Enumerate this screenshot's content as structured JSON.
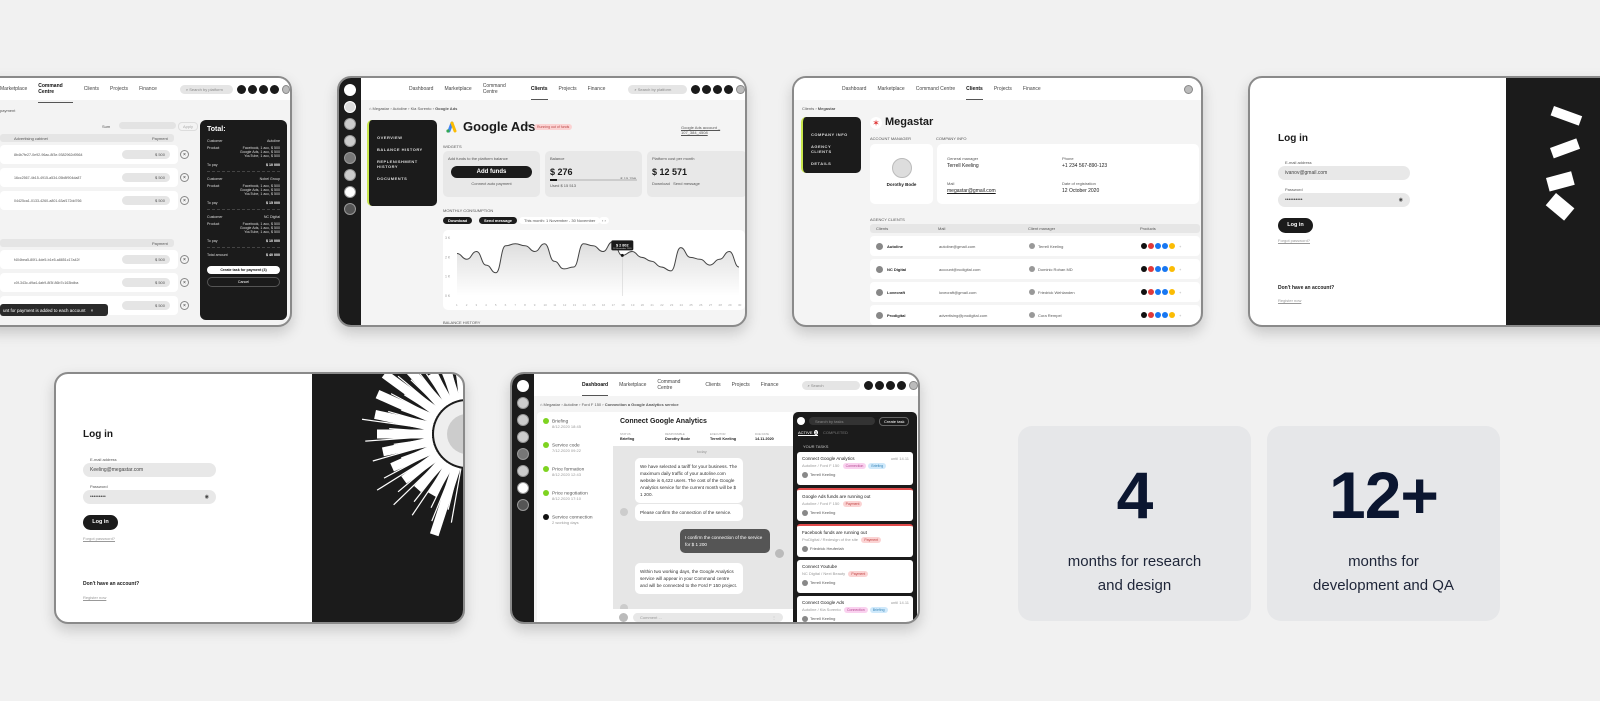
{
  "nav": {
    "items": [
      "Dashboard",
      "Marketplace",
      "Command Centre",
      "Clients",
      "Projects",
      "Finance"
    ]
  },
  "screen_payment": {
    "nav_items": [
      "Marketplace",
      "Command Centre",
      "Clients",
      "Projects",
      "Finance"
    ],
    "active": "Command Centre",
    "search_placeholder": "Search by platform",
    "breadcrumb": "payment",
    "sum_label": "Sum",
    "apply_label": "Apply",
    "col_account": "Advertising cabinet",
    "col_payment": "Payment",
    "rows_a": [
      {
        "id": "8b4b7fe27-0e92-96ac-8f3e-9382962d9564",
        "amount": "$ 500"
      },
      {
        "id": "16cc2567-4b15-4915-a534-05b8f904da87",
        "amount": "$ 500"
      },
      {
        "id": "04425ca1-0133-4260-a801-63af172dd766",
        "amount": "$ 500"
      }
    ],
    "rows_b": [
      {
        "id": "f404bea5-80f1-4de5-b1e5-a8851c17a42f",
        "amount": "$ 500"
      },
      {
        "id": "c0f-343c-d9a4-4ab9-8f3f-86b7c163bdba",
        "amount": "$ 500"
      },
      {
        "id": "",
        "amount": "$ 500"
      }
    ],
    "toast": "unt for payment is added to each account",
    "total": {
      "title": "Total:",
      "customers": [
        {
          "label": "Customer",
          "name": "Autoline",
          "products": [
            "Facebook, 1 acc, $ 500",
            "Google Ads, 1 acc, $ 500",
            "YouTube, 1 acc, $ 500"
          ],
          "to_pay": "$ 10 000"
        },
        {
          "label": "Customer",
          "name": "Nobel Group",
          "products": [
            "Facebook, 1 acc, $ 500",
            "Google Ads, 1 acc, $ 500",
            "YouTube, 1 acc, $ 500"
          ],
          "to_pay": "$ 15 000"
        },
        {
          "label": "Customer",
          "name": "NC Digital",
          "products": [
            "Facebook, 1 acc, $ 500",
            "Google Ads, 1 acc, $ 500",
            "YouTube, 1 acc, $ 500"
          ],
          "to_pay": "$ 10 000"
        }
      ],
      "product_label": "Product",
      "to_pay_label": "To pay",
      "total_amount_label": "Total amount",
      "total_amount": "$ 40 000",
      "create_btn": "Create task for payment (3)",
      "cancel_btn": "Cancel"
    }
  },
  "screen_gads": {
    "active": "Clients",
    "search_placeholder": "Search by platform",
    "breadcrumb": [
      "Megastar",
      "Autoline",
      "Kia Sorento",
      "Google Ads"
    ],
    "menu": [
      "OVERVIEW",
      "BALANCE HISTORY",
      "REPLENISHMENT HISTORY",
      "DOCUMENTS"
    ],
    "title": "Google Ads",
    "badge": "Running out of funds",
    "account_link": "Google Ads account _ 107_384_4508",
    "widgets_label": "WIDGETS",
    "w1_label": "Add funds to the platform balance",
    "w1_btn": "Add funds",
    "w1_link": "Connect auto payment",
    "w2_label": "Balance",
    "w2_value": "$ 276",
    "w2_limit": "$ 15 799",
    "w2_used": "Used $ 15 513",
    "w2_progress": 0.02,
    "w3_label": "Platform cost per month",
    "w3_value": "$ 12 571",
    "w3_download": "Download",
    "w3_send": "Send message",
    "monthly_label": "MONTHLY CONSUMPTION",
    "download_btn": "Download",
    "send_btn": "Send message",
    "period": "This month: 1 November - 30 November",
    "tooltip": "$ 2 802",
    "tooltip_sub": "18 November 2020",
    "balance_history": "BALANCE HISTORY"
  },
  "chart_data": {
    "type": "line",
    "title": "Monthly consumption",
    "x": [
      1,
      2,
      3,
      4,
      5,
      6,
      7,
      8,
      9,
      10,
      11,
      12,
      13,
      14,
      15,
      16,
      17,
      18,
      19,
      20,
      21,
      22,
      23,
      24,
      25,
      26,
      27,
      28,
      29,
      30
    ],
    "values": [
      2.2,
      1.9,
      2.3,
      1.6,
      1.2,
      2.6,
      2.7,
      2.6,
      2.3,
      2.7,
      1.8,
      1.4,
      1.5,
      2.7,
      2.6,
      2.3,
      2.8,
      2.1,
      2.3,
      2.0,
      1.8,
      1.5,
      1.3,
      2.5,
      2.0,
      1.9,
      1.6,
      1.9,
      2.3,
      1.5
    ],
    "ylim": [
      0,
      3
    ],
    "yticks": [
      "0 K",
      "1 K",
      "2 K",
      "3 K"
    ],
    "highlight": {
      "x": 18,
      "label": "$ 2 802"
    }
  },
  "screen_megastar": {
    "active": "Clients",
    "breadcrumb": [
      "Clients",
      "Megastar"
    ],
    "menu": [
      "COMPANY INFO",
      "AGENCY CLIENTS",
      "DETAILS"
    ],
    "title": "Megastar",
    "account_manager_label": "ACCOUNT MANAGER",
    "company_info_label": "COMPANY INFO",
    "manager_name": "Dorothy Bode",
    "general_manager_label": "General manager",
    "general_manager": "Terrell Keeling",
    "phone_label": "Phone",
    "phone": "+1 234 567-890-123",
    "mail_label": "Mail",
    "mail": "megastar@gmail.com",
    "reg_label": "Date of registration",
    "reg_date": "12 October 2020",
    "clients_label": "AGENCY CLIENTS",
    "columns": [
      "Clients",
      "Mail",
      "Client manager",
      "Products"
    ],
    "clients": [
      {
        "name": "Autoline",
        "mail": "autoline@gmail.com",
        "manager": "Terrell Keeling"
      },
      {
        "name": "NC Digital",
        "mail": "account@ncdigital.com",
        "manager": "Dominic Rohan MD"
      },
      {
        "name": "Lovecraft",
        "mail": "lovecraft@gmail.com",
        "manager": "Friedrick Wehlanden"
      },
      {
        "name": "Prodigital",
        "mail": "advertising@prodigital.com",
        "manager": "Cora Rempel"
      }
    ]
  },
  "login1": {
    "title": "Log in",
    "email_label": "E-mail address",
    "email": "ivanov@gmail.com",
    "password_label": "Password",
    "password": "••••••••••",
    "login_btn": "Log in",
    "forgot": "Forgot password?",
    "no_account": "Don't have an account?",
    "register": "Register now"
  },
  "login2": {
    "title": "Log in",
    "email_label": "E-mail address",
    "email": "Keeling@megastar.com",
    "password_label": "Password",
    "password": "•••••••••",
    "login_btn": "Log in",
    "forgot": "Forgot password?",
    "no_account": "Don't have an account?",
    "register": "Register now"
  },
  "screen_dashboard": {
    "active": "Dashboard",
    "search_placeholder": "Search",
    "breadcrumb": [
      "Megastar",
      "Autoline",
      "Ford F 150",
      "Connection a Google Analytics service"
    ],
    "steps": [
      {
        "name": "Briefing",
        "date": "8/12.2020 18:45",
        "done": true
      },
      {
        "name": "Service code",
        "date": "7/12.2020 09:22",
        "done": true
      },
      {
        "name": "Price formation",
        "date": "8/12.2020 12:43",
        "done": true
      },
      {
        "name": "Price negotiation",
        "date": "8/12.2020 17:10",
        "done": true
      },
      {
        "name": "Service connection",
        "date": "2 working days",
        "done": false
      }
    ],
    "chat_title": "Connect Google Analytics",
    "meta": [
      {
        "label": "STATUS",
        "value": "Briefing"
      },
      {
        "label": "RESPONSIBLE",
        "value": "Dorothy Bode"
      },
      {
        "label": "EXECUTOR",
        "value": "Terrell Keeling"
      },
      {
        "label": "DUE DATE",
        "value": "14.11.2020"
      }
    ],
    "today": "today",
    "messages": [
      "We have selected a tariff for your business. The maximum daily traffic of your autoline.com website is 6,422 users. The cost of the Google Analytics service for the current month will be $ 1 200.",
      "Please confirm the connection of the service.",
      "I confirm the connection of the service for $ 1 200",
      "Within two working days, the Google Analytics service will appear in your Command centre and will be connected to the Ford F 150 project."
    ],
    "comment_placeholder": "Comment ...",
    "tasks_search": "Search by tasks",
    "create_task": "Create task",
    "tab_active": "ACTIVE",
    "tab_active_count": "3",
    "tab_completed": "COMPLETED",
    "your_tasks": "YOUR TASKS",
    "tasks": [
      {
        "title": "Connect Google Analytics",
        "sub": "Autoline / Ford F 150",
        "tags": [
          "Connection",
          "Briefing"
        ],
        "user": "Terrell Keeling",
        "due": "until 14.11",
        "alert": false
      },
      {
        "title": "Google Ads funds are running out",
        "sub": "Autoline / Ford F 150",
        "tags": [
          "Payment"
        ],
        "user": "Terrell Keeling",
        "due": "",
        "alert": true
      },
      {
        "title": "Facebook funds are running out",
        "sub": "ProDigital / Redesign of the site",
        "tags": [
          "Payment"
        ],
        "user": "Friedrick Heuferlah",
        "due": "",
        "alert": true
      },
      {
        "title": "Connect Youtube",
        "sub": "NC Digital / Next Beauty",
        "tags": [
          "Payment"
        ],
        "user": "Terrell Keeling",
        "due": "",
        "alert": false
      },
      {
        "title": "Connect Google Ads",
        "sub": "Autoline / Kia Sorento",
        "tags": [
          "Connection",
          "Briefing"
        ],
        "user": "Terrell Keeling",
        "due": "until 14.11",
        "alert": false
      }
    ]
  },
  "stats": [
    {
      "value": "4",
      "desc_line1": "months for research",
      "desc_line2": "and design"
    },
    {
      "value": "12+",
      "desc_line1": "months for",
      "desc_line2": "development and QA"
    }
  ],
  "colors": {
    "dark": "#1b1b1b",
    "accent_green": "#7ed321",
    "alert_red": "#e14b4b",
    "stat_text": "#0b1630",
    "stat_bg": "#e6e7e9"
  }
}
